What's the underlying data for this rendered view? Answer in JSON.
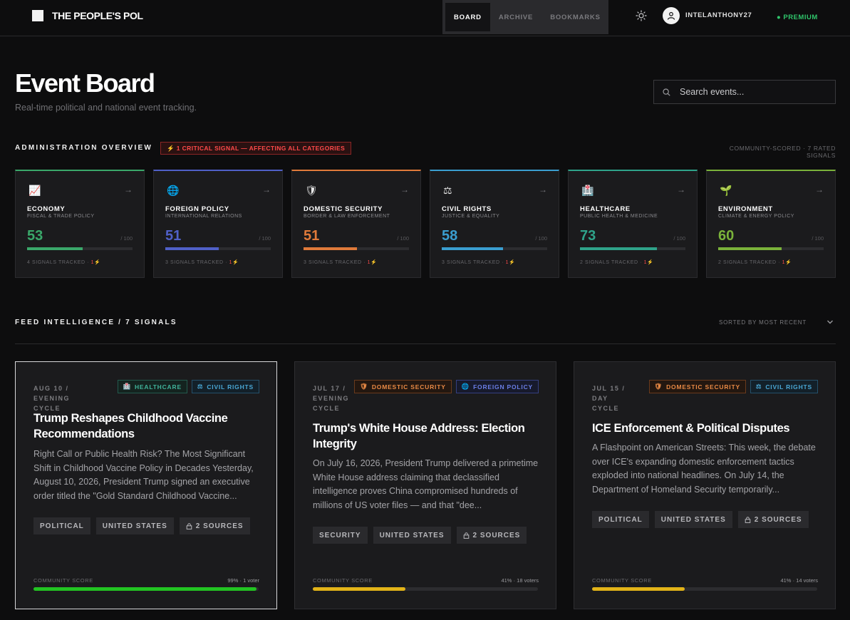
{
  "app": {
    "title": "THE PEOPLE'S POL",
    "nav": [
      "BOARD",
      "ARCHIVE",
      "BOOKMARKS"
    ],
    "active_nav": "BOARD",
    "username": "INTELANTHONY27",
    "plan": "● PREMIUM"
  },
  "header": {
    "title": "Event Board",
    "subtitle": "Real-time political and national event tracking.",
    "search_placeholder": "Search events..."
  },
  "overview": {
    "title": "ADMINISTRATION OVERVIEW",
    "critical_badge": "⚡ 1 CRITICAL SIGNAL — AFFECTING ALL CATEGORIES",
    "meta": "COMMUNITY-SCORED · 7 RATED SIGNALS",
    "max_label": "/ 100",
    "categories": [
      {
        "icon": "📈",
        "icon_name": "chart-up-icon",
        "name": "ECONOMY",
        "sub": "FISCAL & TRADE POLICY",
        "score": "53",
        "score_value": 53,
        "color": "#3aa86a",
        "signals": "4 SIGNALS TRACKED · ",
        "critical": "1",
        "bolt": "⚡"
      },
      {
        "icon": "🌐",
        "icon_name": "globe-icon",
        "name": "FOREIGN POLICY",
        "sub": "INTERNATIONAL RELATIONS",
        "score": "51",
        "score_value": 51,
        "color": "#5060c8",
        "signals": "3 SIGNALS TRACKED · ",
        "critical": "1",
        "bolt": "⚡"
      },
      {
        "icon": "🛡",
        "icon_name": "shield-icon",
        "name": "DOMESTIC SECURITY",
        "sub": "BORDER & LAW ENFORCEMENT",
        "score": "51",
        "score_value": 51,
        "color": "#e07a3a",
        "signals": "3 SIGNALS TRACKED · ",
        "critical": "1",
        "bolt": "⚡"
      },
      {
        "icon": "⚖",
        "icon_name": "scales-icon",
        "name": "CIVIL RIGHTS",
        "sub": "JUSTICE & EQUALITY",
        "score": "58",
        "score_value": 58,
        "color": "#3a9ed0",
        "signals": "3 SIGNALS TRACKED · ",
        "critical": "1",
        "bolt": "⚡"
      },
      {
        "icon": "🏥",
        "icon_name": "hospital-icon",
        "name": "HEALTHCARE",
        "sub": "PUBLIC HEALTH & MEDICINE",
        "score": "73",
        "score_value": 73,
        "color": "#2fa38a",
        "signals": "2 SIGNALS TRACKED · ",
        "critical": "1",
        "bolt": "⚡"
      },
      {
        "icon": "🌱",
        "icon_name": "seedling-icon",
        "name": "ENVIRONMENT",
        "sub": "CLIMATE & ENERGY POLICY",
        "score": "60",
        "score_value": 60,
        "color": "#7ab23a",
        "signals": "2 SIGNALS TRACKED · ",
        "critical": "1",
        "bolt": "⚡"
      }
    ]
  },
  "feed": {
    "title": "FEED INTELLIGENCE / 7 SIGNALS",
    "sort_label": "SORTED BY MOST RECENT",
    "score_label": "COMMUNITY SCORE",
    "posts": [
      {
        "date": "AUG 10 / EVENING CYCLE",
        "tags": [
          {
            "label": "HEALTHCARE",
            "kind": "healthcare",
            "icon": "🏥"
          },
          {
            "label": "CIVIL RIGHTS",
            "kind": "civil",
            "icon": "⚖"
          }
        ],
        "title": "Trump Reshapes Childhood Vaccine Recommendations",
        "body": "Right Call or Public Health Risk? The Most Significant Shift in Childhood Vaccine Policy in Decades Yesterday, August 10, 2026, President Trump signed an executive order titled the \"Gold Standard Childhood Vaccine...",
        "chips": [
          "POLITICAL",
          "UNITED STATES",
          "2 SOURCES"
        ],
        "score_text": "99% · 1 voter",
        "score_pct": 99,
        "score_color": "#22c422"
      },
      {
        "date": "JUL 17 / EVENING CYCLE",
        "tags": [
          {
            "label": "DOMESTIC SECURITY",
            "kind": "domestic",
            "icon": "🛡"
          },
          {
            "label": "FOREIGN POLICY",
            "kind": "foreign",
            "icon": "🌐"
          }
        ],
        "title": "Trump's White House Address: Election Integrity",
        "body": "On July 16, 2026, President Trump delivered a primetime White House address claiming that declassified intelligence proves China compromised hundreds of millions of US voter files — and that \"dee...",
        "chips": [
          "SECURITY",
          "UNITED STATES",
          "2 SOURCES"
        ],
        "score_text": "41% · 18 voters",
        "score_pct": 41,
        "score_color": "#e2b318"
      },
      {
        "date": "JUL 15 / DAY CYCLE",
        "tags": [
          {
            "label": "DOMESTIC SECURITY",
            "kind": "domestic",
            "icon": "🛡"
          },
          {
            "label": "CIVIL RIGHTS",
            "kind": "civil",
            "icon": "⚖"
          }
        ],
        "title": "ICE Enforcement & Political Disputes",
        "body": "A Flashpoint on American Streets: This week, the debate over ICE's expanding domestic enforcement tactics exploded into national headlines. On July 14, the Department of Homeland Security temporarily...",
        "chips": [
          "POLITICAL",
          "UNITED STATES",
          "2 SOURCES"
        ],
        "score_text": "41% · 14 voters",
        "score_pct": 41,
        "score_color": "#e2b318"
      }
    ]
  }
}
